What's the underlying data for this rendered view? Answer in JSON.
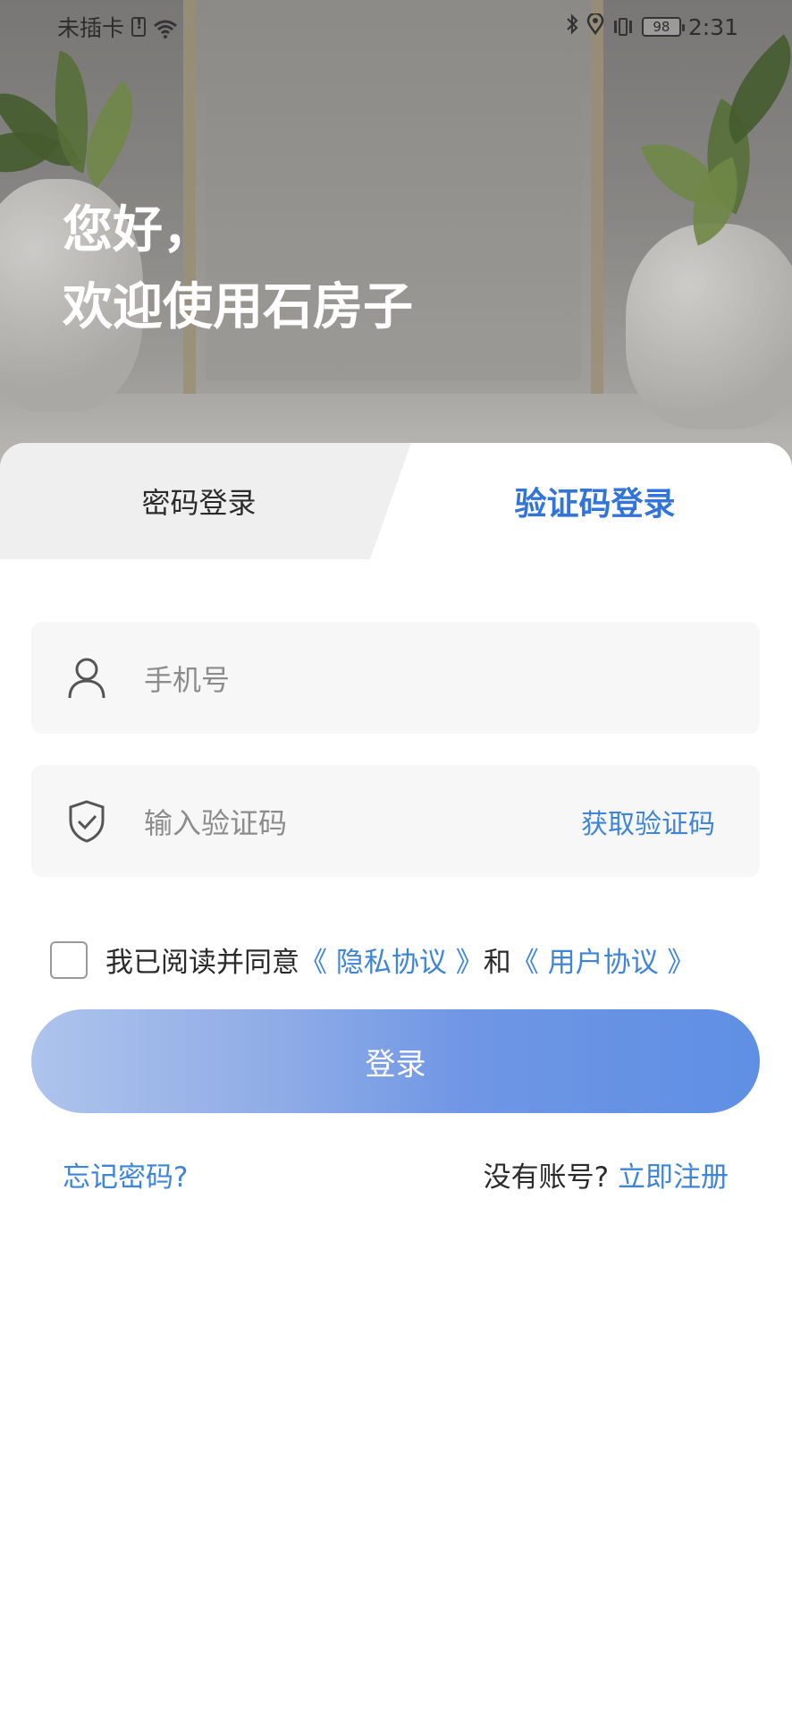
{
  "status_bar": {
    "carrier": "未插卡",
    "battery": "98",
    "time": "2:31"
  },
  "greeting": {
    "line1": "您好，",
    "line2": "欢迎使用石房子"
  },
  "tabs": {
    "password_login": "密码登录",
    "code_login": "验证码登录"
  },
  "form": {
    "phone_placeholder": "手机号",
    "code_placeholder": "输入验证码",
    "get_code": "获取验证码"
  },
  "agreement": {
    "checked": false,
    "prefix": "我已阅读并同意",
    "privacy": "《 隐私协议 》",
    "and": "和",
    "user": "《 用户协议 》"
  },
  "login_button": "登录",
  "footer": {
    "forgot": "忘记密码?",
    "no_account": "没有账号?",
    "register": "立即注册"
  },
  "colors": {
    "accent": "#3274d8",
    "link": "#3e85d8"
  }
}
